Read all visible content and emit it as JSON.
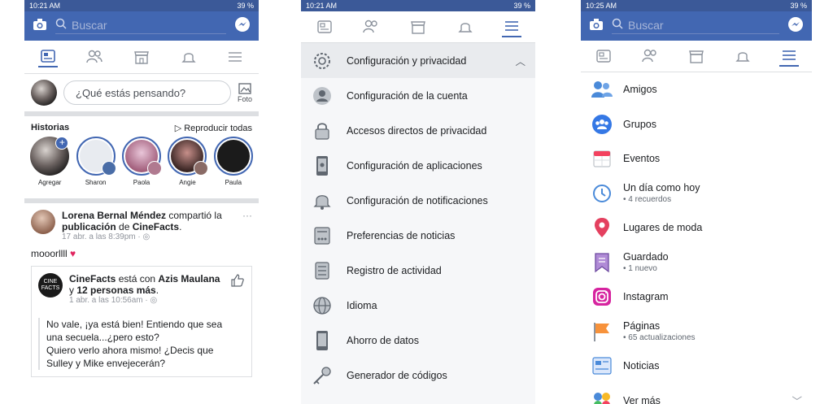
{
  "panel1": {
    "status_time": "10:21 AM",
    "status_right": "39 %",
    "search_placeholder": "Buscar",
    "composer_placeholder": "¿Qué estás pensando?",
    "photo_label": "Foto",
    "stories_title": "Historias",
    "stories_action": "Reproducir todas",
    "stories": [
      "Agregar",
      "Sharon",
      "Paola",
      "Angie",
      "Paula"
    ],
    "post": {
      "author": "Lorena Bernal Méndez",
      "action": "compartió",
      "article": "la",
      "object": "publicación",
      "prep": "de",
      "source": "CineFacts",
      "meta": "17 abr. a las 8:39pm · ",
      "text": "mooorllll",
      "shared": {
        "author": "CineFacts",
        "with": "está con",
        "tagged": "Azis Maulana",
        "and": "y",
        "others": "12 personas más",
        "meta": "1 abr. a las 10:56am · ",
        "logo_text": "CINE FACTS",
        "quote": [
          "No vale, ¡ya está bien! Entiendo que sea",
          "una secuela...¿pero esto?",
          "Quiero verlo ahora mismo! ¿Decis que",
          "Sulley y Mike envejecerán?"
        ]
      }
    }
  },
  "panel2": {
    "status_time": "10:21 AM",
    "status_right": "39 %",
    "header_item": "Configuración y privacidad",
    "items": [
      "Configuración de la cuenta",
      "Accesos directos de privacidad",
      "Configuración de aplicaciones",
      "Configuración de notificaciones",
      "Preferencias de noticias",
      "Registro de actividad",
      "Idioma",
      "Ahorro de datos",
      "Generador de códigos"
    ]
  },
  "panel3": {
    "status_time": "10:25 AM",
    "status_right": "39 %",
    "search_placeholder": "Buscar",
    "items": [
      {
        "label": "Amigos",
        "sub": ""
      },
      {
        "label": "Grupos",
        "sub": ""
      },
      {
        "label": "Eventos",
        "sub": ""
      },
      {
        "label": "Un día como hoy",
        "sub": "• 4 recuerdos"
      },
      {
        "label": "Lugares de moda",
        "sub": ""
      },
      {
        "label": "Guardado",
        "sub": "• 1 nuevo"
      },
      {
        "label": "Instagram",
        "sub": ""
      },
      {
        "label": "Páginas",
        "sub": "• 65 actualizaciones"
      },
      {
        "label": "Noticias",
        "sub": ""
      },
      {
        "label": "Ver más",
        "sub": ""
      }
    ]
  },
  "colors": {
    "brand": "#4267b2",
    "heart": "#e0245e"
  },
  "icons": [
    "camera-icon",
    "search-icon",
    "messenger-icon",
    "news-feed-icon",
    "friends-icon",
    "marketplace-icon",
    "bell-icon",
    "menu-icon"
  ]
}
